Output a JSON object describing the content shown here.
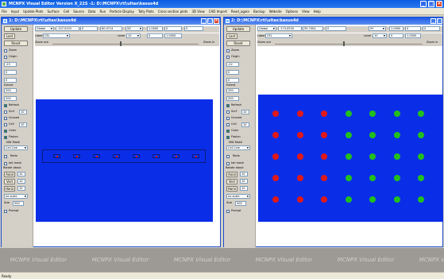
{
  "app": {
    "title": "MCNPX Visual Editor Version X_22S  -1:  D:\\MCNPX\\rtl\\ultas\\kasus4d"
  },
  "menu": [
    "File",
    "Input",
    "Update Plots",
    "Surface",
    "Cell",
    "Source",
    "Data",
    "Run",
    "Particle Display",
    "Tally Plots",
    "Cross section plots",
    "3D View",
    "CAD Import",
    "Read_again",
    "Backup",
    "Website",
    "Options",
    "View",
    "Help"
  ],
  "left_window": {
    "title": "1:  D:\\MCNPX\\rtl\\ultas\\kasus4d",
    "global_label": "Global",
    "coord1": "-107.0103",
    "coord2": "0",
    "coord3": "60.0714",
    "plane": "XZ",
    "scale1": "1.0000",
    "scale2": "0",
    "scale3": "0",
    "scale4": "1.0000",
    "label_value": "CEL",
    "level_label": "Level",
    "level_value": "10",
    "zoom_out": "Zoom out",
    "zoom_in": "Zoom in"
  },
  "right_window": {
    "title": "2:  D:\\MCNPX\\rtl\\ultas\\kasus4d",
    "global_label": "Global",
    "coord1": "-174.0530",
    "coord2": "95.7404",
    "coord3": "0",
    "plane": "XY",
    "scale1": "1.0000",
    "scale2": "0",
    "scale3": "0",
    "scale4": "1.0000",
    "label_value": "CEL",
    "level_label": "Level",
    "level_value": "10",
    "zoom_out": "Zoom out",
    "zoom_in": "Zoom in"
  },
  "panel": {
    "update": "Update",
    "last": "Last",
    "reset": "Reset",
    "label": "Label",
    "zoom": "Zoom",
    "origin": "Origin",
    "origin_left": "-23",
    "origin_right": "-22",
    "y_value": "0",
    "z_value": "0",
    "extent_label": "Extent",
    "extent1": "200",
    "extent2": "200",
    "refresh": "Refresh",
    "surf": "Surf",
    "surf_num": "10",
    "unused": "Unused",
    "cell": "Cell",
    "cell_num": "10",
    "color": "Color",
    "fission": "Fission",
    "mat_label": "MW Mat#",
    "cell_line": "Cell Line",
    "redo": "Redo",
    "tall_mesh": "tall mesh",
    "rotate": "Rotate about",
    "axial": "Axial",
    "axial_num": "10",
    "vert": "Vert",
    "vert_num": "10",
    "horiz": "Horiz",
    "horiz_num": "10",
    "no_scale": "no scale",
    "size": "Size",
    "size_num": "500",
    "prompt": "Prompt"
  },
  "right_plot": {
    "red_columns": 3,
    "green_columns": 4,
    "rows": 5,
    "red": "#e01818",
    "green": "#22c01c"
  },
  "watermark": "MCNPX Visual Editor",
  "status": "Ready",
  "colors": {
    "plot_blue": "#0a2ee8",
    "title_blue": "#0a5ce0"
  }
}
